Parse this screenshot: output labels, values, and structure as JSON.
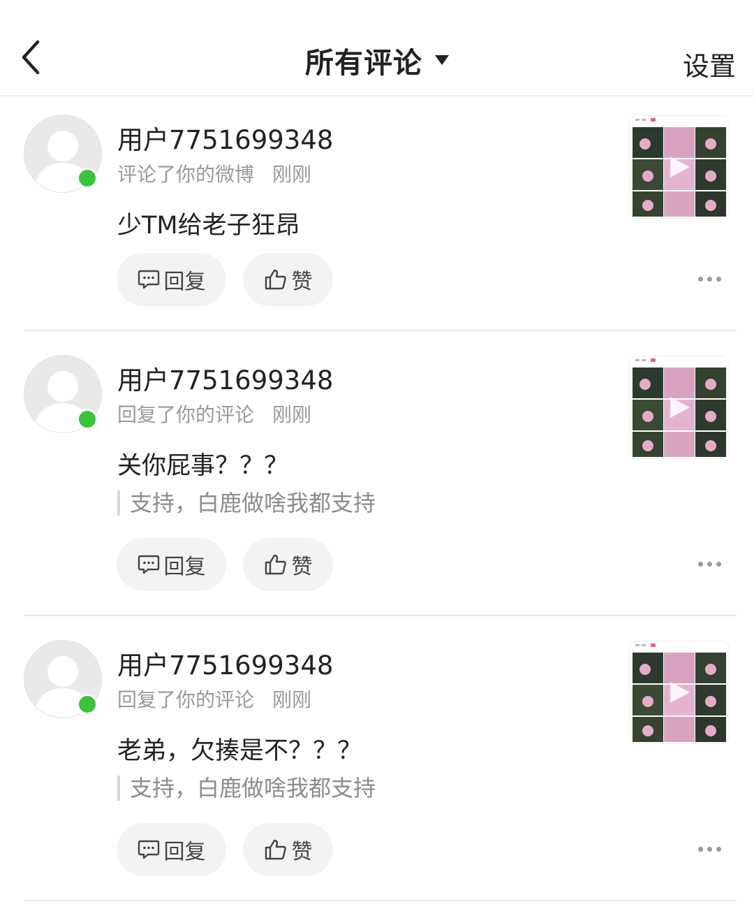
{
  "header": {
    "title": "所有评论",
    "settings_label": "设置"
  },
  "comments": [
    {
      "username": "用户7751699348",
      "action": "评论了你的微博",
      "time": "刚刚",
      "content": "少TM给老子狂昂",
      "quote": null,
      "reply_label": "回复",
      "like_label": "赞"
    },
    {
      "username": "用户7751699348",
      "action": "回复了你的评论",
      "time": "刚刚",
      "content": "关你屁事？？？",
      "quote": "支持，白鹿做啥我都支持",
      "reply_label": "回复",
      "like_label": "赞"
    },
    {
      "username": "用户7751699348",
      "action": "回复了你的评论",
      "time": "刚刚",
      "content": "老弟，欠揍是不？？？",
      "quote": "支持，白鹿做啥我都支持",
      "reply_label": "回复",
      "like_label": "赞"
    }
  ],
  "colors": {
    "online": "#39c43a",
    "divider": "#ececec",
    "button_bg": "#f3f3f3",
    "meta_text": "#999999"
  },
  "icons": {
    "back": "chevron-left-icon",
    "dropdown": "caret-down-icon",
    "reply": "comment-bubble-icon",
    "like": "thumbs-up-icon",
    "more": "more-dots-icon",
    "avatar": "default-avatar-icon"
  }
}
